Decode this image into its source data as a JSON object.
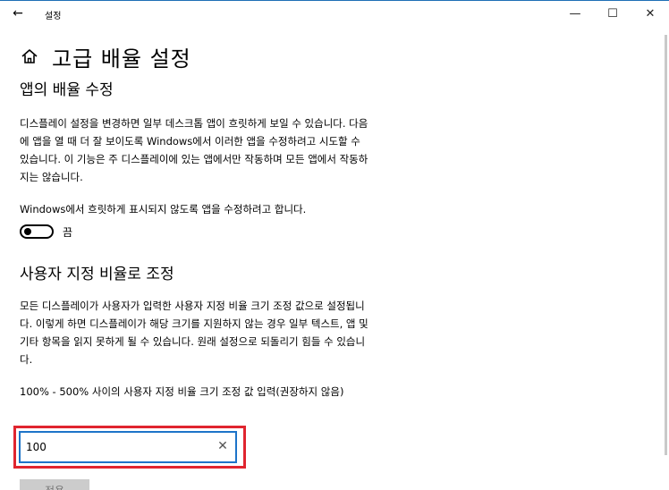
{
  "window": {
    "title": "설정",
    "minimize": "—",
    "maximize": "☐",
    "close": "✕",
    "back": "←"
  },
  "page": {
    "title": "고급 배율 설정"
  },
  "fix_apps": {
    "title": "앱의 배율 수정",
    "description": "디스플레이 설정을 변경하면 일부 데스크톱 앱이 흐릿하게 보일 수 있습니다. 다음에 앱을 열 때 더 잘 보이도록 Windows에서 이러한 앱을 수정하려고 시도할 수 있습니다. 이 기능은 주 디스플레이에 있는 앱에서만 작동하며 모든 앱에서 작동하지는 않습니다.",
    "toggle_prompt": "Windows에서 흐릿하게 표시되지 않도록 앱을 수정하려고 합니다.",
    "toggle_state": "끔"
  },
  "custom_scaling": {
    "title": "사용자 지정 비율로 조정",
    "description": "모든 디스플레이가 사용자가 입력한 사용자 지정 비율 크기 조정 값으로 설정됩니다. 이렇게 하면 디스플레이가 해당 크기를 지원하지 않는 경우 일부 텍스트, 앱 및 기타 항목을 읽지 못하게 될 수 있습니다. 원래 설정으로 되돌리기 힘들 수 있습니다.",
    "input_label": "100% - 500% 사이의 사용자 지정 비율 크기 조정 값 입력(권장하지 않음)",
    "input_value": "100",
    "clear": "✕",
    "apply_label": "적용"
  },
  "colors": {
    "focus_border": "#1d74c9",
    "highlight": "#e0252f",
    "button_bg": "#cccccc"
  }
}
